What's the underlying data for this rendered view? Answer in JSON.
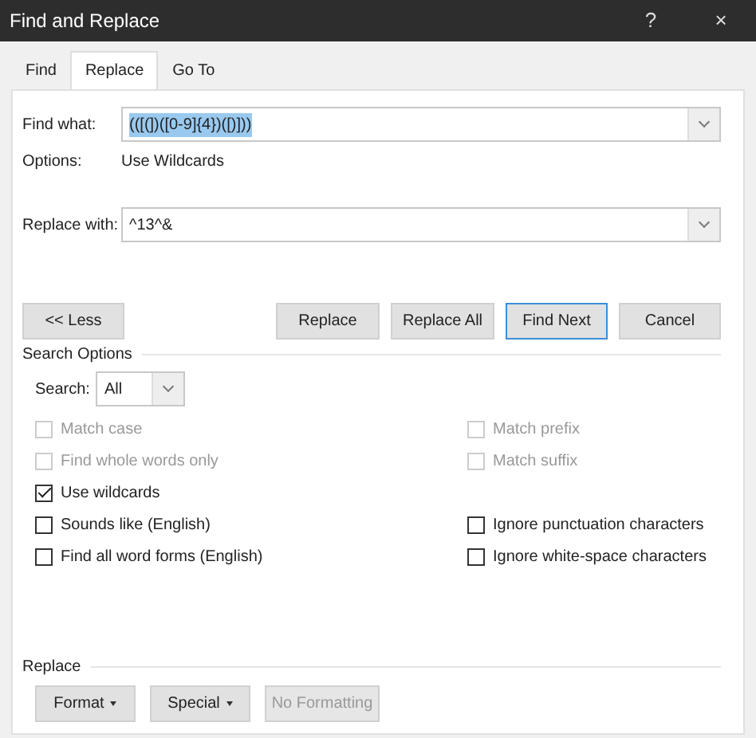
{
  "window": {
    "title": "Find and Replace",
    "help": "?",
    "close": "×"
  },
  "tabs": [
    {
      "label": "Find",
      "selected": false
    },
    {
      "label": "Replace",
      "selected": true
    },
    {
      "label": "Go To",
      "selected": false
    }
  ],
  "find_what": {
    "label": "Find what:",
    "value": "(([(])([0-9]{4})([)]))",
    "text_selected": true
  },
  "options": {
    "label": "Options:",
    "value": "Use Wildcards"
  },
  "replace_with": {
    "label": "Replace with:",
    "value": "^13^&"
  },
  "buttons": [
    {
      "label": "<< Less",
      "default": false
    },
    {
      "label": "Replace",
      "default": false
    },
    {
      "label": "Replace All",
      "default": false
    },
    {
      "label": "Find Next",
      "default": true
    },
    {
      "label": "Cancel",
      "default": false
    }
  ],
  "search_options": {
    "heading": "Search Options",
    "search": {
      "label": "Search:",
      "value": "All"
    },
    "left": [
      {
        "label": "Match case",
        "checked": false,
        "disabled": true
      },
      {
        "label": "Find whole words only",
        "checked": false,
        "disabled": true
      },
      {
        "label": "Use wildcards",
        "checked": true,
        "disabled": false
      },
      {
        "label": "Sounds like (English)",
        "checked": false,
        "disabled": false
      },
      {
        "label": "Find all word forms (English)",
        "checked": false,
        "disabled": false
      }
    ],
    "right": [
      {
        "label": "Match prefix",
        "checked": false,
        "disabled": true
      },
      {
        "label": "Match suffix",
        "checked": false,
        "disabled": true
      },
      {
        "label": "Ignore punctuation characters",
        "checked": false,
        "disabled": false
      },
      {
        "label": "Ignore white-space characters",
        "checked": false,
        "disabled": false
      }
    ]
  },
  "replace_section": {
    "heading": "Replace",
    "buttons": [
      {
        "label": "Format",
        "dropdown": true,
        "disabled": false
      },
      {
        "label": "Special",
        "dropdown": true,
        "disabled": false
      },
      {
        "label": "No Formatting",
        "dropdown": false,
        "disabled": true
      }
    ]
  }
}
